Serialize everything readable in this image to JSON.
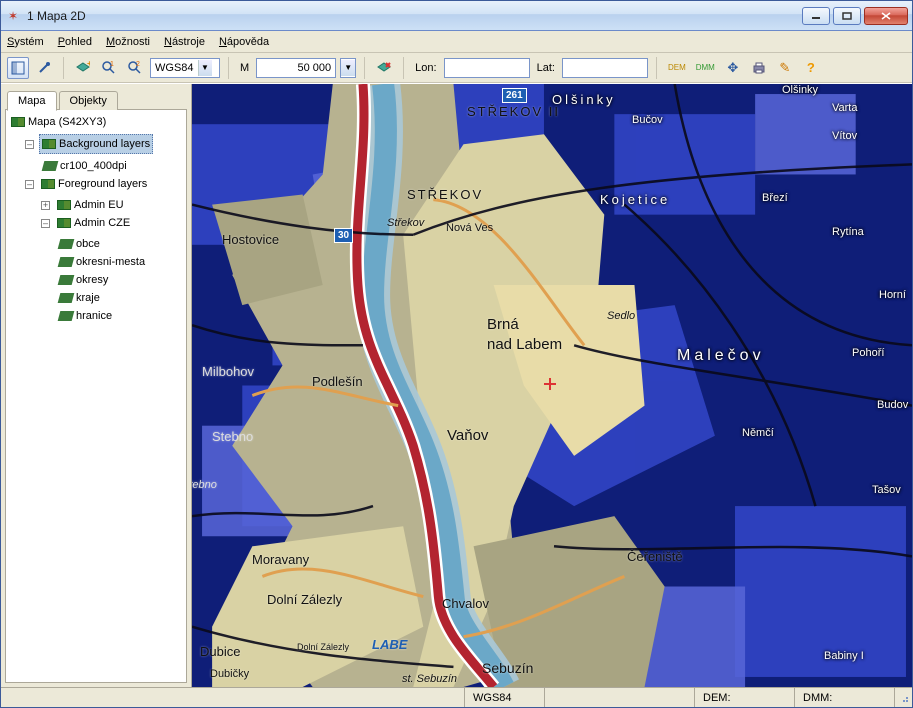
{
  "window": {
    "title": "1 Mapa 2D"
  },
  "menu": {
    "system": "Systém",
    "view": "Pohled",
    "options": "Možnosti",
    "tools": "Nástroje",
    "help": "Nápověda"
  },
  "toolbar": {
    "coord_system": "WGS84",
    "scale_label": "M",
    "scale_value": "50 000",
    "lon_label": "Lon:",
    "lon_value": "",
    "lat_label": "Lat:",
    "lat_value": "",
    "dem_chip": "DEM",
    "dmm_chip": "DMM"
  },
  "sidebar": {
    "tab_map": "Mapa",
    "tab_objects": "Objekty",
    "tree": {
      "root": "Mapa (S42XY3)",
      "background": "Background layers",
      "bg_child": "cr100_400dpi",
      "foreground": "Foreground layers",
      "fg_admin_eu": "Admin EU",
      "fg_admin_cze": "Admin CZE",
      "cze_children": {
        "obce": "obce",
        "okresni_mesta": "okresni-mesta",
        "okresy": "okresy",
        "kraje": "kraje",
        "hranice": "hranice"
      }
    }
  },
  "map": {
    "labels": {
      "strekov2": "STŘEKOV II",
      "strekov": "STŘEKOV",
      "nova_ves": "Nová Ves",
      "strekov_it": "Střekov",
      "hostovice": "Hostovice",
      "kojetice": "Kojetice",
      "brna": "Brná",
      "nad_labem": "nad Labem",
      "podlesim": "Podlešín",
      "milbohov": "Milbohov",
      "stebno": "Stebno",
      "stebno_it": "Stebno",
      "vanov": "Vaňov",
      "sedlo": "Sedlo",
      "malecov": "Malečov",
      "pohori": "Pohoří",
      "brezi": "Březí",
      "rytina": "Rytína",
      "nemci": "Němčí",
      "tasov": "Tašov",
      "moravany": "Moravany",
      "dolni_zalezly": "Dolní Zálezly",
      "dolni_zalezly_sm": "Dolní Zálezly",
      "chvalov": "Chvalov",
      "labe": "LABE",
      "cereniste": "Čeřeniště",
      "sebuzin": "Sebuzín",
      "st_sebuzin": "st. Sebuzín",
      "dubice": "Dubice",
      "dubicky": "Dubičky",
      "olsinky": "Olšinky",
      "vlsinky": "Olšinky",
      "bucov": "Bučov",
      "vitov": "Vítov",
      "varta": "Varta",
      "babiny": "Babiny I",
      "horni": "Horní",
      "budov": "Budov",
      "rd261": "261",
      "rd30": "30"
    }
  },
  "status": {
    "coord_sys": "WGS84",
    "dem": "DEM:",
    "dmm": "DMM:"
  }
}
